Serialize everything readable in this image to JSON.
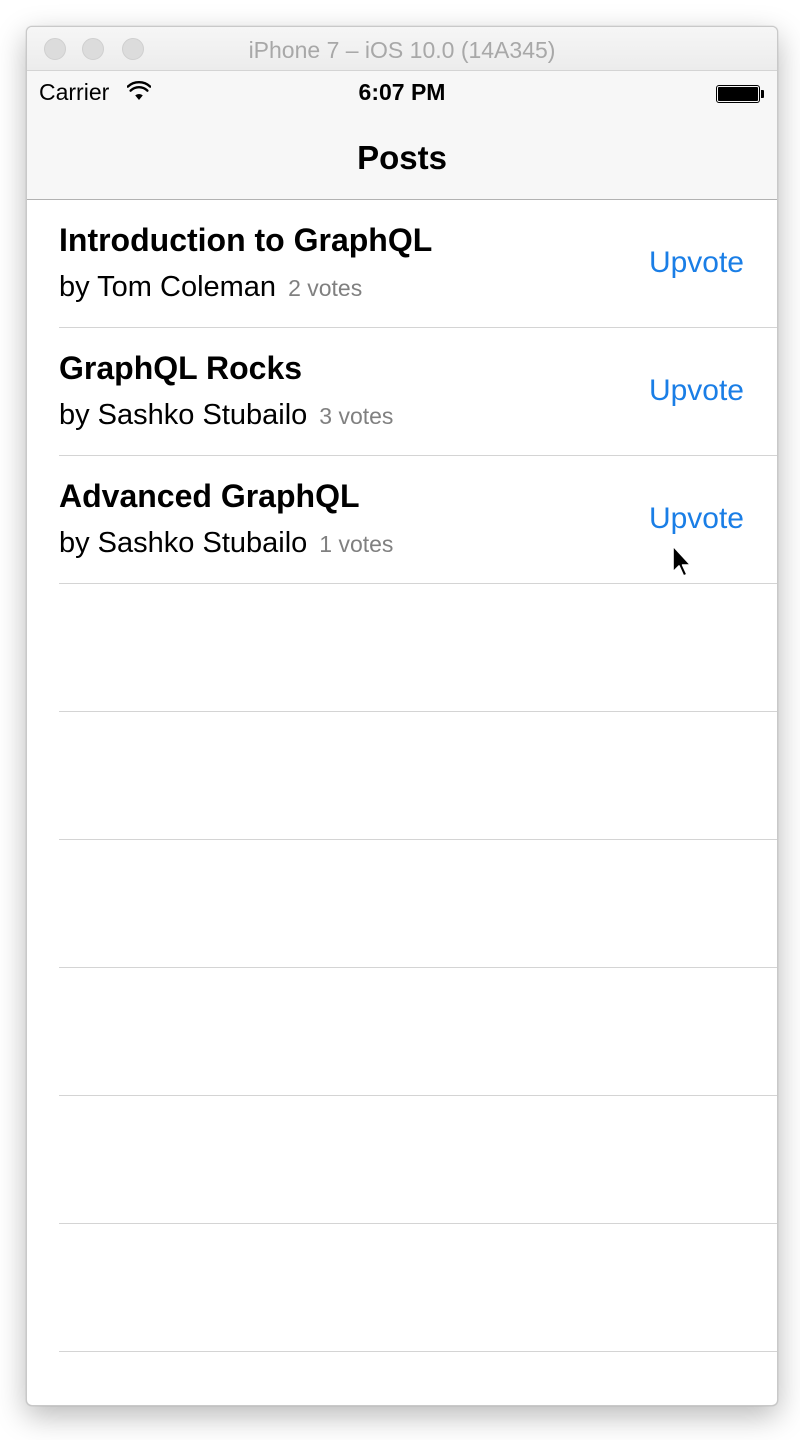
{
  "window": {
    "title": "iPhone 7 – iOS 10.0 (14A345)"
  },
  "status_bar": {
    "carrier": "Carrier",
    "time": "6:07 PM",
    "wifi_icon": "wifi-icon",
    "battery_icon": "battery-icon",
    "battery_level": 1.0
  },
  "nav": {
    "title": "Posts"
  },
  "posts": [
    {
      "title": "Introduction to GraphQL",
      "author": "by Tom Coleman",
      "votes": "2 votes",
      "action": "Upvote"
    },
    {
      "title": "GraphQL Rocks",
      "author": "by Sashko Stubailo",
      "votes": "3 votes",
      "action": "Upvote"
    },
    {
      "title": "Advanced GraphQL",
      "author": "by Sashko Stubailo",
      "votes": "1 votes",
      "action": "Upvote"
    }
  ],
  "colors": {
    "tint": "#1a7ee6",
    "secondary_text": "#808080",
    "separator": "#d4d4d4"
  }
}
